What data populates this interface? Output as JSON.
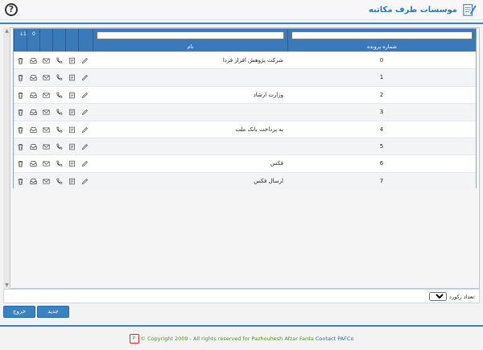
{
  "app": {
    "title": "موسسات طرف مکاتبه",
    "help_label": "?"
  },
  "grid": {
    "headers": {
      "id": "شماره پرونده",
      "name": "نام",
      "badge": "↓1",
      "badge2": "0"
    },
    "filters": {
      "id_placeholder": "",
      "name_placeholder": ""
    },
    "rows": [
      {
        "id": "0",
        "name": "شرکت پژوهش افزار فردا"
      },
      {
        "id": "1",
        "name": ""
      },
      {
        "id": "2",
        "name": "وزارت ارشاد"
      },
      {
        "id": "3",
        "name": ""
      },
      {
        "id": "4",
        "name": "به پرداخت بانک ملت"
      },
      {
        "id": "5",
        "name": ""
      },
      {
        "id": "6",
        "name": "فکس"
      },
      {
        "id": "7",
        "name": "ارسال فکس"
      }
    ],
    "row_icons": [
      "edit-icon",
      "notes-icon",
      "phone-icon",
      "mail-icon",
      "inbox-icon",
      "delete-icon"
    ]
  },
  "pager": {
    "records_label": "تعداد رکورد:",
    "page_size": "10"
  },
  "buttons": {
    "new": "جدید",
    "exit": "خروج"
  },
  "footer": {
    "logo": "P",
    "copyright": "© Copyright 2009 - All rights reserved for Pazhouhesh Afzar Farda",
    "contact": "Contact PAFCo"
  },
  "colors": {
    "accent": "#3a82c0",
    "header": "#3a7ab8",
    "copyright": "#5a8a2a"
  }
}
